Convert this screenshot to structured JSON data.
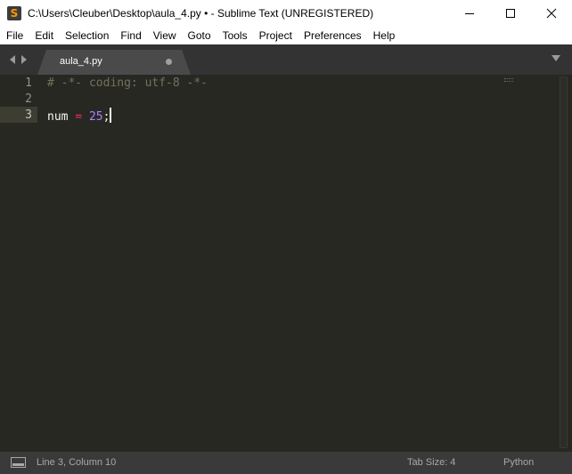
{
  "window": {
    "title": "C:\\Users\\Cleuber\\Desktop\\aula_4.py • - Sublime Text (UNREGISTERED)",
    "app_icon_letter": "S"
  },
  "menu": {
    "items": [
      "File",
      "Edit",
      "Selection",
      "Find",
      "View",
      "Goto",
      "Tools",
      "Project",
      "Preferences",
      "Help"
    ]
  },
  "tabs": [
    {
      "label": "aula_4.py",
      "modified": true
    }
  ],
  "editor": {
    "line_numbers": [
      "1",
      "2",
      "3"
    ],
    "active_line": 3,
    "lines": [
      {
        "comment": "# -*- coding: utf-8 -*-"
      },
      {},
      {
        "identifier": "num",
        "operator": "=",
        "number": "25",
        "terminator": ";"
      }
    ]
  },
  "status": {
    "position": "Line 3, Column 10",
    "tab_size": "Tab Size: 4",
    "syntax": "Python"
  },
  "colors": {
    "editor_bg": "#272822",
    "comment": "#75715e",
    "operator": "#f92672",
    "number": "#ae81ff",
    "plain": "#f8f8f2",
    "app_icon_accent": "#ff9800"
  },
  "icons": {
    "app": "sublime-logo-icon",
    "minimize": "minimize-icon",
    "maximize": "maximize-icon",
    "close": "close-icon",
    "nav_back": "chevron-left-icon",
    "nav_forward": "chevron-right-icon",
    "tab_modified": "dot-icon",
    "tab_list": "triangle-down-icon",
    "panel": "panel-toggle-icon"
  }
}
